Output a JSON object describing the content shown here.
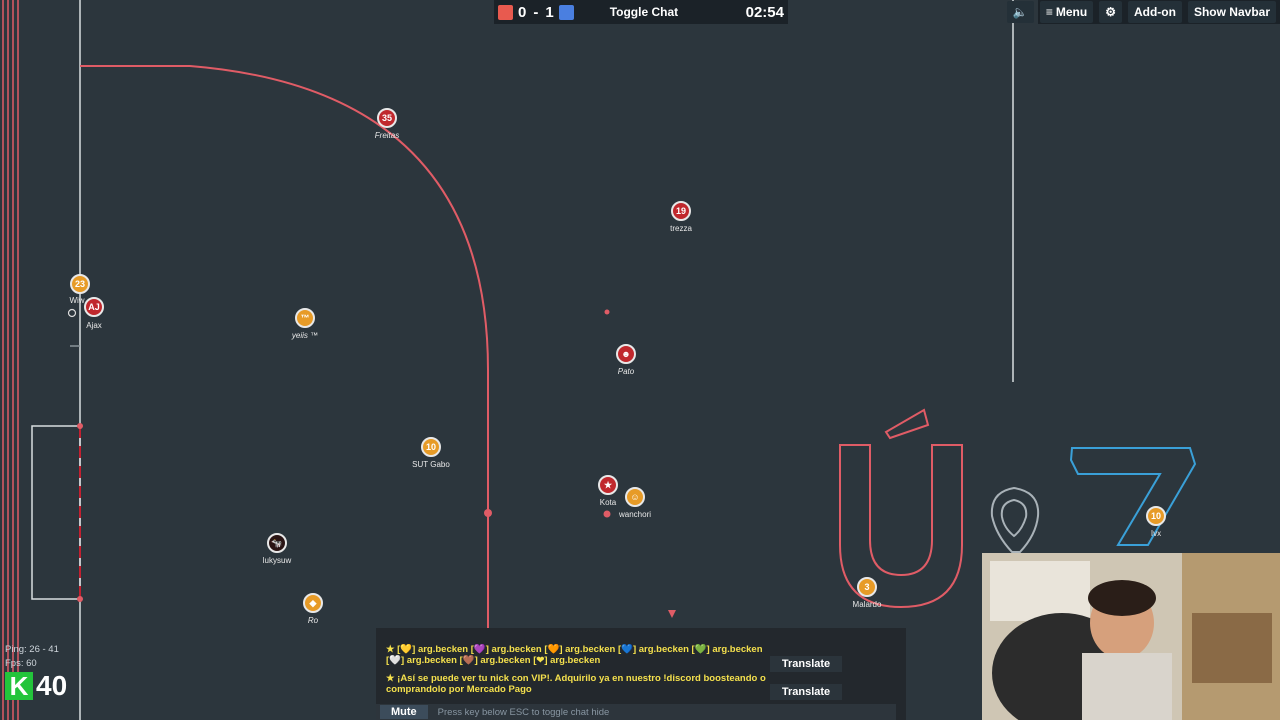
{
  "scoreboard": {
    "red_color": "#e85a4f",
    "blue_color": "#4a7fe0",
    "score_red": "0",
    "separator": "-",
    "score_blue": "1",
    "toggle_chat_label": "Toggle Chat",
    "timer": "02:54"
  },
  "topbar": {
    "sound_icon": "speaker-icon",
    "menu_label": "Menu",
    "settings_icon": "gear-icon",
    "addon_label": "Add-on",
    "show_navbar_label": "Show Navbar"
  },
  "players": [
    {
      "id": "freitas",
      "number": "35",
      "name": "Freitas",
      "team": "red"
    },
    {
      "id": "trezza",
      "number": "19",
      "name": "trezza",
      "team": "red"
    },
    {
      "id": "wiw",
      "number": "23",
      "name": "Wiw",
      "team": "orange"
    },
    {
      "id": "ajax",
      "number": "AJ",
      "name": "Ajax",
      "team": "red"
    },
    {
      "id": "yeiis",
      "number": "™",
      "name": "yeiis ™",
      "team": "orange"
    },
    {
      "id": "pato",
      "number": "☻",
      "name": "Pato",
      "team": "red"
    },
    {
      "id": "sutgabo",
      "number": "10",
      "name": "SUT Gabo",
      "team": "orange"
    },
    {
      "id": "kota",
      "number": "★",
      "name": "Kota",
      "team": "red"
    },
    {
      "id": "wanchori",
      "number": "☺",
      "name": "wanchori",
      "team": "orange"
    },
    {
      "id": "lukysuw",
      "number": "🐄",
      "name": "lukysuw",
      "team": "dark"
    },
    {
      "id": "ro",
      "number": "◆",
      "name": "Ro",
      "team": "orange"
    },
    {
      "id": "malardo",
      "number": "3",
      "name": "Malardo",
      "team": "orange"
    },
    {
      "id": "rrx",
      "number": "10",
      "name": "Ivx",
      "team": "orange"
    }
  ],
  "logo": {
    "text_u": "Ú",
    "text_amp": "&",
    "text_7": "7"
  },
  "chat": {
    "line1": "★ [💛] arg.becken [💜] arg.becken [🧡] arg.becken [💙] arg.becken [💚] arg.becken [🤍] arg.becken [🤎] arg.becken [❤] arg.becken",
    "line2": "★ ¡Así se puede ver tu nick con VIP!. Adquirilo ya en nuestro !discord boosteando o comprandolo por Mercado Pago",
    "translate_label": "Translate",
    "mute_label": "Mute",
    "input_placeholder": "Press key below ESC to toggle chat hide"
  },
  "stats": {
    "ping": "Ping: 26 - 41",
    "fps": "Fps: 60",
    "k_label": "K",
    "k_value": "40"
  }
}
